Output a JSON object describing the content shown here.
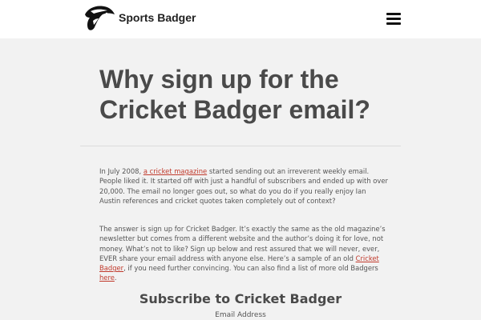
{
  "header": {
    "site_name": "Sports Badger",
    "logo_icon": "badger-logo-icon",
    "menu_icon": "hamburger-menu-icon"
  },
  "article": {
    "title": "Why sign up for the Cricket Badger email?",
    "p1": {
      "t1": "In July 2008, ",
      "link1": "a cricket magazine",
      "t2": " started sending out an irreverent weekly email. People liked it. It started off with just a handful of subscribers and ended up with over 20,000. The email no longer goes out, so what do you do if you really enjoy Ian Austin references and cricket quotes taken completely out of context?"
    },
    "p2": {
      "t1": "The answer is sign up for Cricket Badger. It’s exactly the same as the old magazine’s newsletter but comes from a different website and the author’s doing it for love, not money. What’s not to like? Sign up below and rest assured that we will never, ever, EVER share your email address with anyone else. Here’s a sample of an old ",
      "link1": "Cricket Badger",
      "t2": ", if you need further convincing. You can also find a list of more old Badgers ",
      "link2": "here",
      "t3": "."
    }
  },
  "subscribe": {
    "title": "Subscribe to Cricket Badger",
    "email_label": "Email Address"
  },
  "colors": {
    "link": "#c0392b",
    "heading": "#4a4a4a",
    "background": "#f2f2f2"
  }
}
